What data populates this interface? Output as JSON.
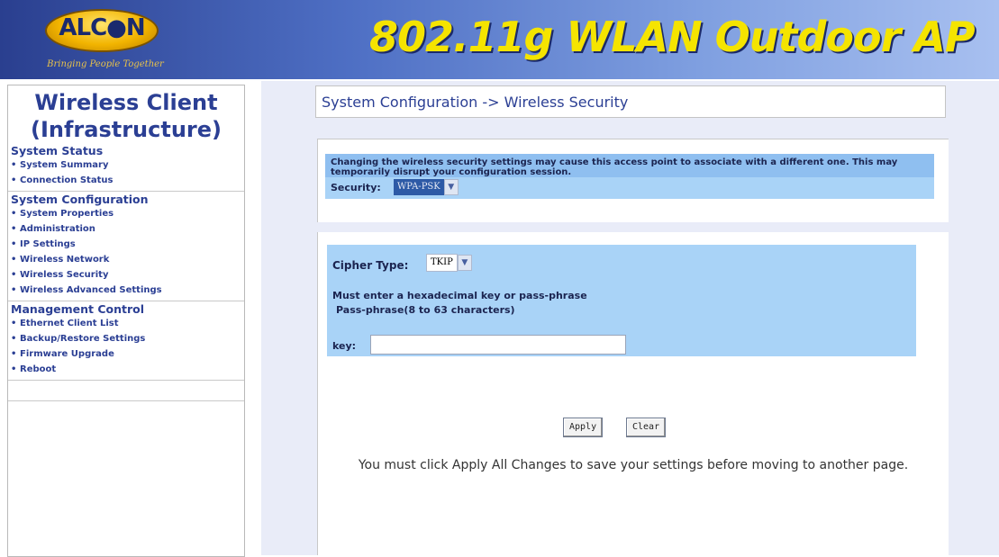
{
  "header": {
    "logo_text": "ALC●N",
    "logo_tagline": "Bringing People Together",
    "banner_title": "802.11g WLAN Outdoor AP"
  },
  "sidebar": {
    "title_line1": "Wireless Client",
    "title_line2": "(Infrastructure)",
    "sections": [
      {
        "heading": "System Status",
        "items": [
          "System Summary",
          "Connection Status"
        ]
      },
      {
        "heading": "System Configuration",
        "items": [
          "System Properties",
          "Administration",
          "IP Settings",
          "Wireless Network",
          "Wireless Security",
          "Wireless Advanced Settings"
        ]
      },
      {
        "heading": "Management Control",
        "items": [
          "Ethernet Client List",
          "Backup/Restore Settings",
          "Firmware Upgrade",
          "Reboot"
        ]
      }
    ]
  },
  "main": {
    "breadcrumb": "System Configuration -> Wireless Security",
    "warning": "Changing the wireless security settings may cause this access point to associate with a different one. This may temporarily disrupt your configuration session.",
    "security_label": "Security:",
    "security_value": "WPA-PSK",
    "cipher_label": "Cipher Type:",
    "cipher_value": "TKIP",
    "hint_line1": "Must enter a hexadecimal key or pass-phrase",
    "hint_line2": "Pass-phrase(8 to 63 characters)",
    "key_label": "key:",
    "key_value": "",
    "apply_label": "Apply",
    "clear_label": "Clear",
    "footer_note": "You must click Apply All Changes to save your settings before moving to another page."
  },
  "colors": {
    "banner_title": "#f5e400",
    "link_blue": "#2b3f94",
    "warning_bg": "#8fbff0",
    "field_bg": "#a9d3f7",
    "main_bg": "#e9ecf8"
  }
}
